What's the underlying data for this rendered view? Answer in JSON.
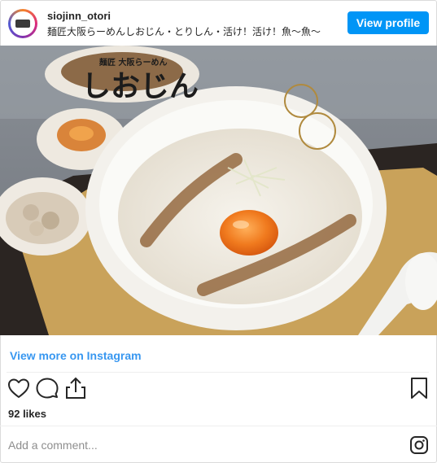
{
  "header": {
    "username": "siojinn_otori",
    "caption": "麺匠大阪らーめんしおじん・とりしん・活け！活け！魚～魚～",
    "view_profile_label": "View profile"
  },
  "post": {
    "image_subject": "ramen bowl with raw egg yolk",
    "logo_text": "しおじん",
    "logo_subtext": "麺匠 大阪らーめん"
  },
  "footer": {
    "view_more_label": "View more on Instagram",
    "likes": "92 likes",
    "comment_placeholder": "Add a comment..."
  },
  "icons": {
    "like": "heart-icon",
    "comment": "comment-icon",
    "share": "share-icon",
    "save": "bookmark-icon",
    "instagram": "instagram-icon"
  },
  "colors": {
    "accent": "#0095f6",
    "link": "#3897f0",
    "text": "#262626",
    "muted": "#8e8e8e"
  }
}
